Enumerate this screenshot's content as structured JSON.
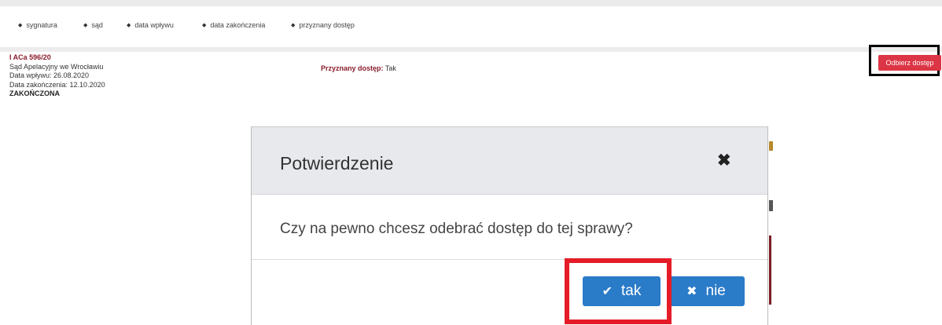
{
  "table_header": {
    "columns": [
      {
        "label": "sygnatura",
        "icon": "sort-icon"
      },
      {
        "label": "sąd",
        "icon": "sort-icon"
      },
      {
        "label": "data wpływu",
        "icon": "sort-icon"
      },
      {
        "label": "data zakończenia",
        "icon": "sort-icon"
      },
      {
        "label": "przyznany dostęp",
        "icon": "sort-icon"
      }
    ]
  },
  "case": {
    "signature": "I ACa 596/20",
    "court": "Sąd Apelacyjny we Wrocławiu",
    "date_received": "Data wpływu: 26.08.2020",
    "date_closed": "Data zakończenia: 12.10.2020",
    "status": "ZAKOŃCZONA",
    "access_label": "Przyznany dostęp:",
    "access_value": "Tak",
    "revoke_button": "Odbierz dostęp"
  },
  "modal": {
    "title": "Potwierdzenie",
    "close_icon": "close-icon",
    "question": "Czy na pewno chcesz odebrać dostęp do tej sprawy?",
    "confirm_button": "tak",
    "confirm_icon": "check-icon",
    "cancel_button": "nie",
    "cancel_icon": "x-icon"
  },
  "colors": {
    "primary_button": "#2a7bc8",
    "danger_button": "#dc3545",
    "highlight_red": "#e51c28",
    "highlight_black": "#000000",
    "case_accent": "#8a1c2a"
  }
}
